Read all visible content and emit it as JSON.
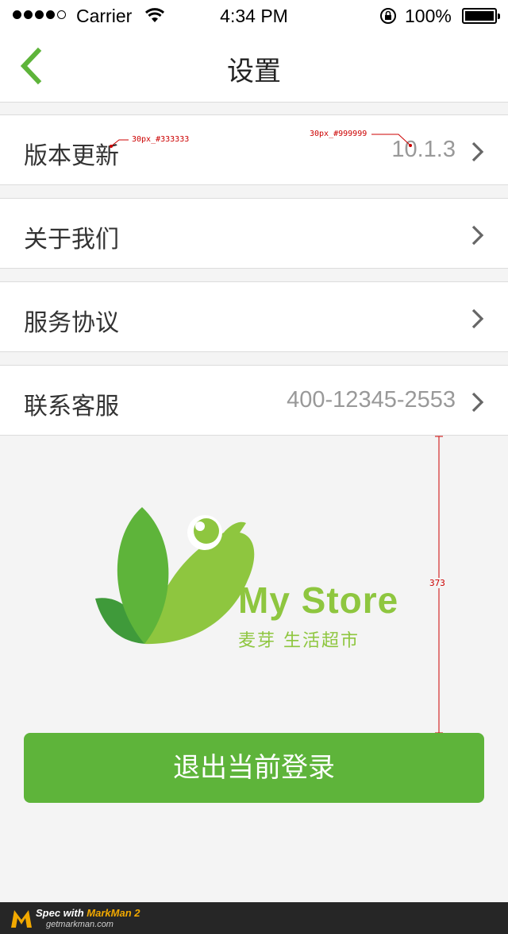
{
  "status_bar": {
    "carrier": "Carrier",
    "time": "4:34 PM",
    "battery": "100%",
    "signal_bars_filled": 4,
    "signal_bars_total": 5
  },
  "nav": {
    "title": "设置",
    "back_icon": "chevron-left-icon",
    "accent_color": "#5eb43a"
  },
  "settings": {
    "items": [
      {
        "label": "版本更新",
        "value": "10.1.3"
      },
      {
        "label": "关于我们",
        "value": ""
      },
      {
        "label": "服务协议",
        "value": ""
      },
      {
        "label": "联系客服",
        "value": "400-12345-2553"
      }
    ]
  },
  "spec_notes": {
    "label_spec": "30px_#333333",
    "value_spec": "30px_#999999",
    "dimension": "373"
  },
  "logo": {
    "name": "My Store",
    "subtitle": "麦芽 生活超市",
    "colors": {
      "light_green": "#8ec63f",
      "dark_green": "#5eb43a"
    }
  },
  "logout": {
    "label": "退出当前登录",
    "color": "#5eb43a"
  },
  "markman": {
    "prefix": "Spec with ",
    "brand": "MarkMan 2",
    "url": "getmarkman.com"
  }
}
